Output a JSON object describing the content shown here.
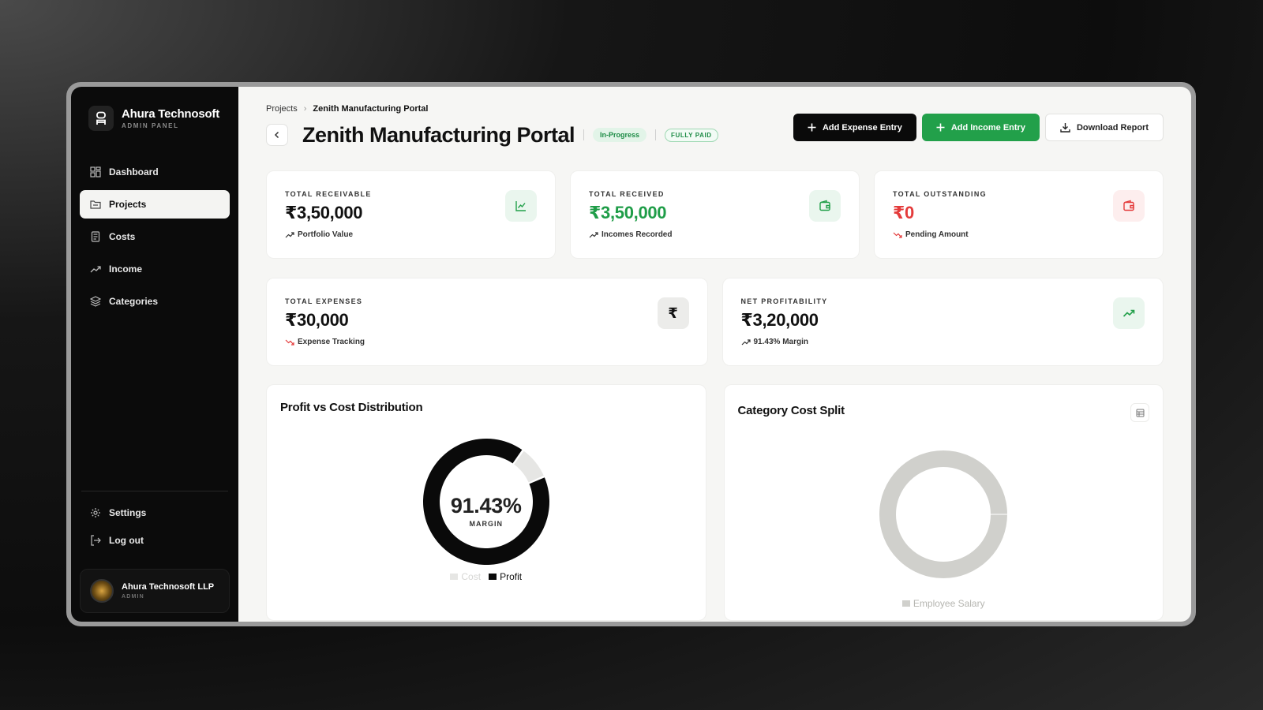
{
  "brand": {
    "name": "Ahura Technosoft",
    "subtitle": "ADMIN PANEL"
  },
  "nav": [
    {
      "label": "Dashboard",
      "icon": "grid-icon"
    },
    {
      "label": "Projects",
      "icon": "folder-icon",
      "active": true
    },
    {
      "label": "Costs",
      "icon": "document-icon"
    },
    {
      "label": "Income",
      "icon": "trend-up-icon"
    },
    {
      "label": "Categories",
      "icon": "layers-icon"
    }
  ],
  "bottom_nav": {
    "settings": "Settings",
    "logout": "Log out"
  },
  "profile": {
    "name": "Ahura Technosoft LLP",
    "role": "ADMIN"
  },
  "breadcrumb": {
    "parent": "Projects",
    "current": "Zenith Manufacturing Portal"
  },
  "header": {
    "title": "Zenith Manufacturing Portal",
    "status": "In-Progress",
    "payment": "FULLY PAID"
  },
  "actions": {
    "add_expense": "Add Expense Entry",
    "add_income": "Add Income Entry",
    "download": "Download Report"
  },
  "stats": {
    "receivable": {
      "label": "TOTAL RECEIVABLE",
      "value": "₹3,50,000",
      "sub": "Portfolio Value"
    },
    "received": {
      "label": "TOTAL RECEIVED",
      "value": "₹3,50,000",
      "sub": "Incomes Recorded"
    },
    "outstanding": {
      "label": "TOTAL OUTSTANDING",
      "value": "₹0",
      "sub": "Pending Amount"
    },
    "expenses": {
      "label": "TOTAL EXPENSES",
      "value": "₹30,000",
      "sub": "Expense Tracking",
      "icon_glyph": "₹"
    },
    "profit": {
      "label": "NET PROFITABILITY",
      "value": "₹3,20,000",
      "sub": "91.43% Margin"
    }
  },
  "colors": {
    "green": "#22a04a",
    "red": "#e43b3b",
    "black": "#0a0a0a",
    "cost": "#e6e6e4",
    "salary": "#d0d0cc"
  },
  "charts": {
    "profit_vs_cost": {
      "title": "Profit vs Cost Distribution",
      "center_value": "91.43%",
      "center_label": "MARGIN"
    },
    "category_split": {
      "title": "Category Cost Split"
    }
  },
  "chart_data": [
    {
      "type": "pie",
      "title": "Profit vs Cost Distribution",
      "categories": [
        "Cost",
        "Profit"
      ],
      "values": [
        30000,
        320000
      ],
      "legend": "bottom"
    },
    {
      "type": "pie",
      "title": "Category Cost Split",
      "categories": [
        "Employee Salary"
      ],
      "values": [
        30000
      ],
      "legend": "bottom"
    }
  ]
}
